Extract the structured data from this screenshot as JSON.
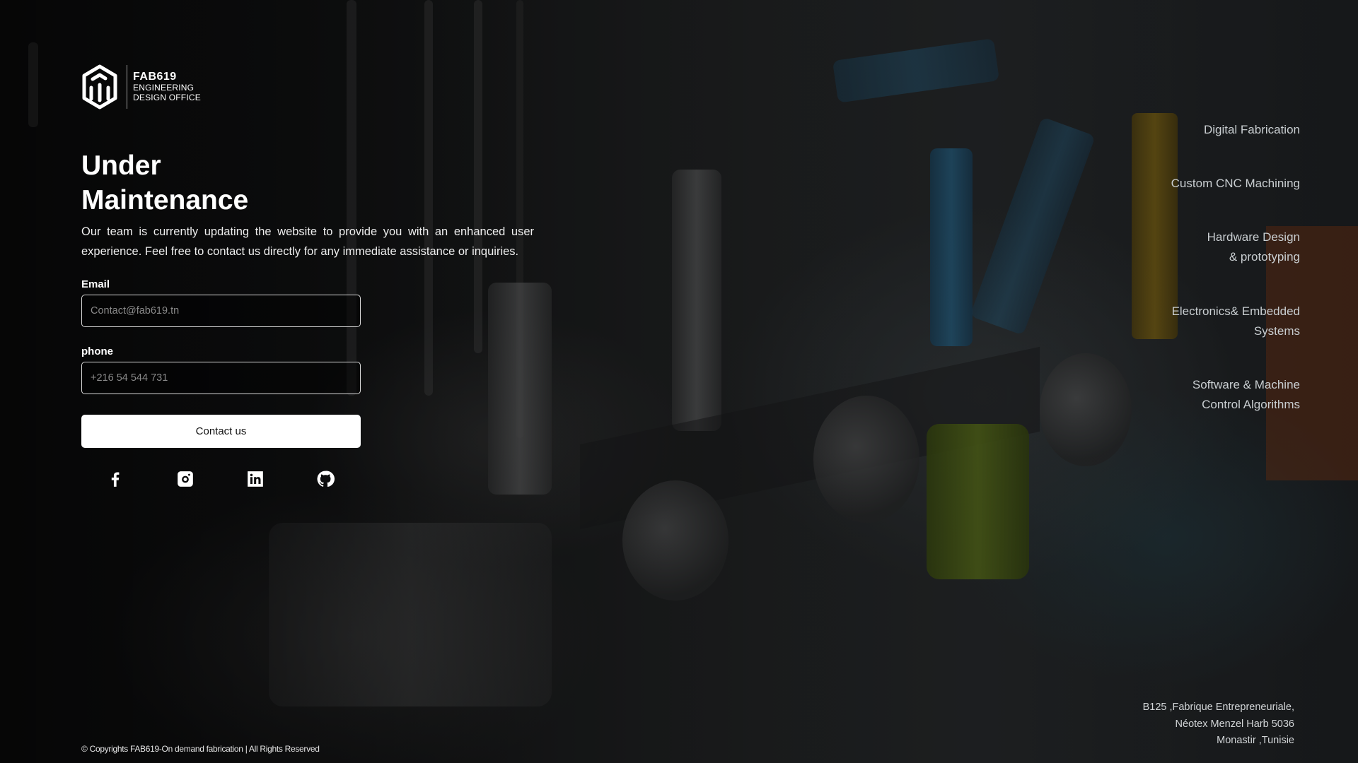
{
  "brand": {
    "name": "FAB619",
    "subtitle_line1": "ENGINEERING",
    "subtitle_line2": "DESIGN OFFICE"
  },
  "hero": {
    "title_line1": "Under",
    "title_line2": "Maintenance",
    "description": "Our team is currently updating the website to provide you with an enhanced user experience. Feel free to contact us directly for any immediate assistance or inquiries."
  },
  "form": {
    "email_label": "Email",
    "email_placeholder": "Contact@fab619.tn",
    "email_value": "",
    "phone_label": "phone",
    "phone_placeholder": "+216 54 544 731",
    "phone_value": "",
    "submit_label": "Contact us"
  },
  "socials": [
    {
      "name": "facebook",
      "icon": "facebook-icon"
    },
    {
      "name": "instagram",
      "icon": "instagram-icon"
    },
    {
      "name": "linkedin",
      "icon": "linkedin-icon"
    },
    {
      "name": "github",
      "icon": "github-icon"
    }
  ],
  "services": [
    {
      "line1": "Digital Fabrication",
      "line2": ""
    },
    {
      "line1": "Custom CNC Machining",
      "line2": ""
    },
    {
      "line1": "Hardware Design",
      "line2": "& prototyping"
    },
    {
      "line1": "Electronics& Embedded",
      "line2": "Systems"
    },
    {
      "line1": "Software & Machine",
      "line2": "Control Algorithms"
    }
  ],
  "address": {
    "line1": "B125 ,Fabrique Entrepreneuriale,",
    "line2": "Néotex Menzel Harb 5036",
    "line3": "Monastir ,Tunisie"
  },
  "footer": {
    "copyright": "© Copyrights FAB619-On demand fabrication | All Rights Reserved"
  },
  "colors": {
    "text_primary": "#ffffff",
    "text_muted": "#c9ced1",
    "button_bg": "#ffffff",
    "button_text": "#111111"
  }
}
